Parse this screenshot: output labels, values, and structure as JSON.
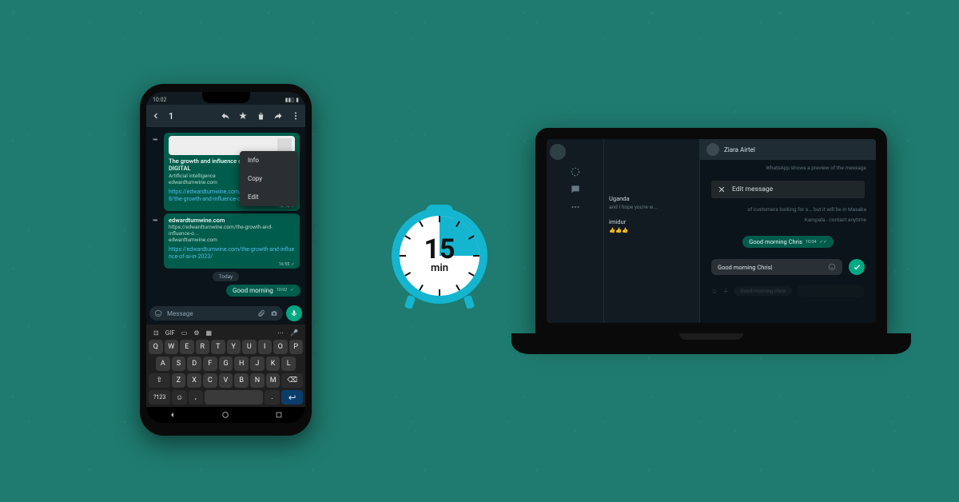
{
  "clock": {
    "value": "15",
    "unit": "min"
  },
  "phone": {
    "status": {
      "time": "10:02",
      "carrier_icons": "▸",
      "signal": "▮▮▯",
      "battery": "▮"
    },
    "header": {
      "selected_count": "1"
    },
    "context_menu": {
      "info": "Info",
      "copy": "Copy",
      "edit": "Edit"
    },
    "bubble1": {
      "title": "The growth and influence of AI in 2023 - DIGITAL",
      "subtitle": "Artificial intelligence",
      "domain": "edwardtumwine.com",
      "link": "https://edwardtumwine.com/index.php/2023/08/08/the-growth-and-influence-of-ai-in-2023/",
      "ts": "14:14",
      "tick": "✓"
    },
    "bubble2": {
      "title": "edwardtumwine.com",
      "subtitle": "https://edwardtumwine.com/the-growth-and-influence-o...",
      "domain": "edwardtumwine.com",
      "link": "https://edwardtumwine.com/the-growth-and-influence-of-ai-in-2023/",
      "ts": "16:55",
      "tick": "✓"
    },
    "today": "Today",
    "gm": {
      "text": "Good morning",
      "ts": "10:02",
      "tick": "✓"
    },
    "input": {
      "placeholder": "Message"
    },
    "keyboard": {
      "strip": {
        "sticker": "⊡",
        "gif": "GIF",
        "clipboard": "▭",
        "settings": "⚙",
        "translate": "▦",
        "more": "⋯",
        "mic": "🎤"
      },
      "row1": [
        "Q",
        "W",
        "E",
        "R",
        "T",
        "Y",
        "U",
        "I",
        "O",
        "P"
      ],
      "row2": [
        "A",
        "S",
        "D",
        "F",
        "G",
        "H",
        "J",
        "K",
        "L"
      ],
      "row3_shift": "⇧",
      "row3": [
        "Z",
        "X",
        "C",
        "V",
        "B",
        "N",
        "M"
      ],
      "row3_back": "⌫",
      "row4": {
        "num": "?123",
        "emoji": "☺",
        "comma": ",",
        "space": "",
        "period": ".",
        "enter": "↵"
      }
    }
  },
  "laptop": {
    "contact_name": "Ziara Airtel",
    "left_items": [
      {
        "name": "",
        "preview": ""
      },
      {
        "name": "",
        "preview": ""
      }
    ],
    "list": [
      {
        "name": "Uganda",
        "preview": "and I hope you're w..."
      },
      {
        "name": "imidur",
        "preview": "👍👍👍"
      }
    ],
    "dim1": "WhatsApp shows a preview of the message",
    "dim2": "of customers looking for s... but it will be in Masaka",
    "dim3": "Kampala - contact anytime",
    "edit_label": "Edit message",
    "gm": {
      "text": "Good morning Chris",
      "ts": "10:04",
      "tick": "✓✓"
    },
    "edit_value": "Good morning Chris|",
    "ghost_pill": "Good morning chris"
  }
}
